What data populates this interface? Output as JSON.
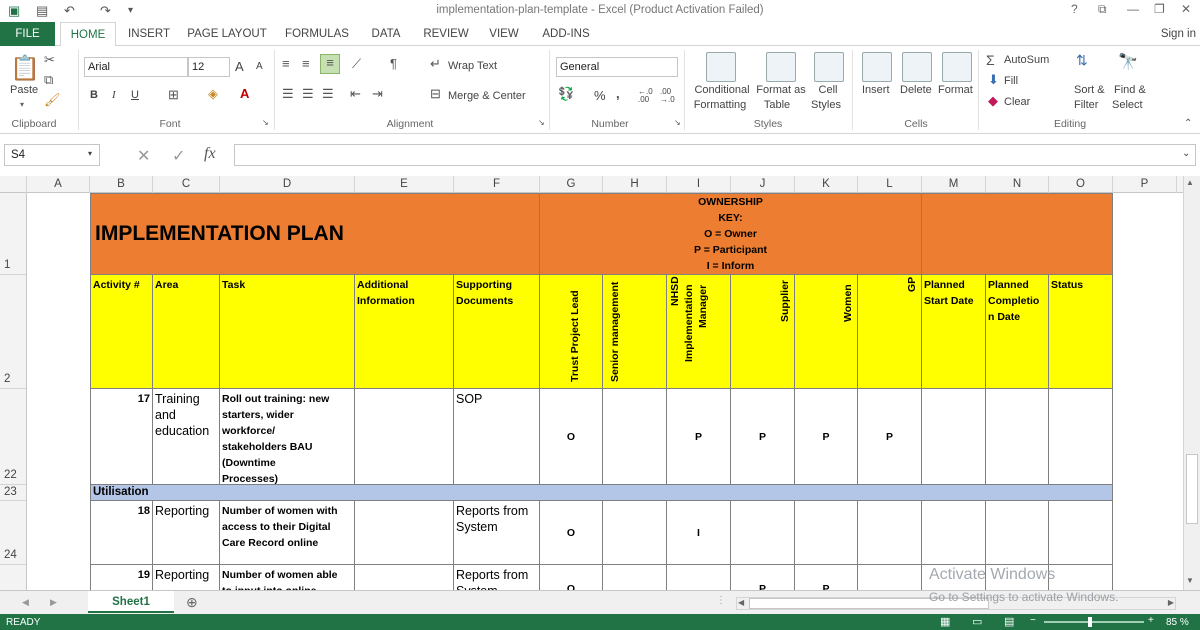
{
  "window": {
    "title": "implementation-plan-template - Excel (Product Activation Failed)",
    "help": "?",
    "minimize": "—",
    "restore": "❐",
    "close": "✕"
  },
  "qat": {
    "save": "💾",
    "undo": "↶",
    "redo": "↷"
  },
  "tabs": {
    "file": "FILE",
    "home": "HOME",
    "insert": "INSERT",
    "page_layout": "PAGE LAYOUT",
    "formulas": "FORMULAS",
    "data": "DATA",
    "review": "REVIEW",
    "view": "VIEW",
    "addins": "ADD-INS",
    "signin": "Sign in"
  },
  "ribbon": {
    "clipboard": {
      "label": "Clipboard",
      "paste": "Paste"
    },
    "font": {
      "label": "Font",
      "name": "Arial",
      "size": "12",
      "bold": "B",
      "italic": "I",
      "underline": "U",
      "grow": "A",
      "shrink": "A"
    },
    "alignment": {
      "label": "Alignment",
      "wrap": "Wrap Text",
      "merge": "Merge & Center"
    },
    "number": {
      "label": "Number",
      "format": "General",
      "percent": "%",
      "comma": ",",
      "inc": "←.0 .00",
      "dec": ".00 →.0"
    },
    "styles": {
      "label": "Styles",
      "conditional_1": "Conditional",
      "conditional_2": "Formatting",
      "format_as_1": "Format as",
      "format_as_2": "Table",
      "cell_styles_1": "Cell",
      "cell_styles_2": "Styles"
    },
    "cells": {
      "label": "Cells",
      "insert": "Insert",
      "delete": "Delete",
      "format": "Format"
    },
    "editing": {
      "label": "Editing",
      "autosum": "AutoSum",
      "fill": "Fill",
      "clear": "Clear",
      "sort_1": "Sort &",
      "sort_2": "Filter",
      "find_1": "Find &",
      "find_2": "Select"
    }
  },
  "formula_bar": {
    "name_box": "S4",
    "cancel": "✕",
    "enter": "✓",
    "fx": "fx",
    "value": ""
  },
  "columns": [
    "A",
    "B",
    "C",
    "D",
    "E",
    "F",
    "G",
    "H",
    "I",
    "J",
    "K",
    "L",
    "M",
    "N",
    "O",
    "P"
  ],
  "rows": [
    "1",
    "2",
    "22",
    "23",
    "24"
  ],
  "sheet": {
    "title": "IMPLEMENTATION PLAN",
    "ownership_key": [
      "OWNERSHIP",
      "KEY:",
      "O = Owner",
      "P = Participant",
      "I = Inform"
    ],
    "headers": {
      "activity": "Activity #",
      "area": "Area",
      "task": "Task",
      "additional": "Additional Information",
      "supporting": "Supporting Documents",
      "trust": "Trust Project Lead",
      "senior": "Senior management",
      "nhsd_1": "NHSD",
      "nhsd_2": "Implementation",
      "nhsd_3": "Manager",
      "supplier": "Supplier",
      "women": "Women",
      "gp": "GP",
      "planned_start": "Planned Start Date",
      "planned_completion": "Planned Completio n Date",
      "status": "Status"
    },
    "row22": {
      "activity": "17",
      "area": "Training and education",
      "task": "Roll out training: new starters, wider workforce/ stakeholders BAU (Downtime Processes)",
      "supporting": "SOP",
      "g": "O",
      "i": "P",
      "j": "P",
      "k": "P",
      "l": "P"
    },
    "row23": {
      "section": "Utilisation"
    },
    "row24": {
      "activity": "18",
      "area": "Reporting",
      "task": "Number of women with access to their Digital Care Record online",
      "supporting": "Reports from System",
      "g": "O",
      "i": "I"
    },
    "row25": {
      "activity": "19",
      "area": "Reporting",
      "task": "Number of women able to input into online",
      "supporting": "Reports from System",
      "g": "O",
      "j": "P",
      "k": "P"
    }
  },
  "sheet_tab": "Sheet1",
  "watermark": {
    "line1": "Activate Windows",
    "line2": "Go to Settings to activate Windows."
  },
  "status": {
    "ready": "READY",
    "zoom": "85 %"
  },
  "colors": {
    "excel_green": "#217346",
    "title_orange": "#ed7d31",
    "header_yellow": "#ffff00",
    "section_blue": "#b4c6e7"
  }
}
